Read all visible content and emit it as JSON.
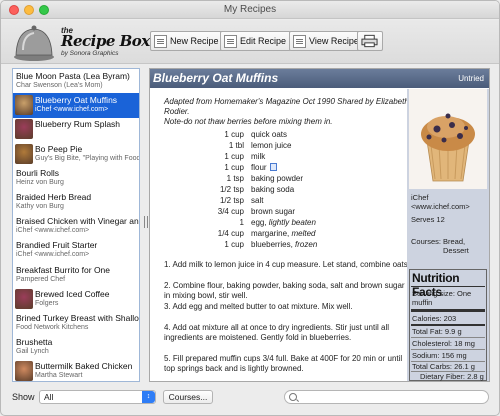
{
  "window": {
    "title": "My Recipes"
  },
  "logo": {
    "the": "the",
    "title": "Recipe Box",
    "subtitle": "by Sonora Graphics"
  },
  "toolbar": {
    "new_label": "New Recipe",
    "edit_label": "Edit Recipe",
    "view_label": "View Recipe"
  },
  "sidebar": {
    "items": [
      {
        "name": "Blue Moon Pasta (Lea Byram)",
        "source": "Char Swenson (Lea's Mom)",
        "thumb": false
      },
      {
        "name": "Blueberry Oat Muffins",
        "source": "iChef <www.ichef.com>",
        "thumb": true,
        "selected": true
      },
      {
        "name": "Blueberry Rum Splash",
        "source": "",
        "thumb": true
      },
      {
        "name": "Bo Peep Pie",
        "source": "Guy's Big Bite, \"Playing with Food\"",
        "thumb": true
      },
      {
        "name": "Bourli Rolls",
        "source": "Heinz von Burg",
        "thumb": false
      },
      {
        "name": "Braided Herb Bread",
        "source": "Kathy von Burg",
        "thumb": false
      },
      {
        "name": "Braised Chicken with Vinegar and ...",
        "source": "iChef <www.ichef.com>",
        "thumb": false
      },
      {
        "name": "Brandied Fruit Starter",
        "source": "iChef <www.ichef.com>",
        "thumb": false
      },
      {
        "name": "Breakfast Burrito for One",
        "source": "Pampered Chef",
        "thumb": false
      },
      {
        "name": "Brewed Iced Coffee",
        "source": "Folgers",
        "thumb": true
      },
      {
        "name": "Brined Turkey Breast with Shallot ...",
        "source": "Food Network Kitchens",
        "thumb": false
      },
      {
        "name": "Brushetta",
        "source": "Gail Lynch",
        "thumb": false
      },
      {
        "name": "Buttermilk Baked Chicken",
        "source": "Martha Stewart",
        "thumb": true
      }
    ]
  },
  "recipe": {
    "title": "Blueberry Oat Muffins",
    "status": "Untried",
    "intro": "Adapted from Homemaker's Magazine Oct 1990 Shared by Elizabeth Rodier.",
    "note": "Note-do not thaw berries before mixing them in.",
    "ingredients": [
      {
        "qty": "1 cup",
        "item": "quick oats",
        "note": ""
      },
      {
        "qty": "1 tbl",
        "item": "lemon juice",
        "note": ""
      },
      {
        "qty": "1 cup",
        "item": "milk",
        "note": ""
      },
      {
        "qty": "1 cup",
        "item": "flour",
        "note": ""
      },
      {
        "qty": "1 tsp",
        "item": "baking powder",
        "note": ""
      },
      {
        "qty": "1/2 tsp",
        "item": "baking soda",
        "note": ""
      },
      {
        "qty": "1/2 tsp",
        "item": "salt",
        "note": ""
      },
      {
        "qty": "3/4 cup",
        "item": "brown sugar",
        "note": ""
      },
      {
        "qty": "1",
        "item": "egg, ",
        "note": "lightly beaten"
      },
      {
        "qty": "1/4 cup",
        "item": "margarine, ",
        "note": "melted"
      },
      {
        "qty": "1 cup",
        "item": "blueberries, ",
        "note": "frozen"
      }
    ],
    "steps": [
      "1. Add milk to lemon juice in 4 cup measure. Let stand, combine oats.",
      "2. Combine flour, baking powder, baking soda, salt and brown sugar in mixing bowl, stir well.",
      "3. Add egg and melted butter to oat mixture. Mix well.",
      "4. Add oat mixture all at once to dry ingredients. Stir just until all ingredients are moistened. Gently fold in blueberries.",
      "5. Fill prepared muffin cups 3/4 full. Bake at 400F for 20 min or until top springs back and is lightly browned."
    ],
    "source": "iChef <www.ichef.com>",
    "serves": "Serves 12",
    "courses_label": "Courses:",
    "courses_value": "Bread, Dessert"
  },
  "nutrition": {
    "title": "Nutrition Facts",
    "serving": "Serving size: One muffin",
    "calories": "Calories: 203",
    "total_fat": "Total Fat: 9.9 g",
    "cholesterol": "Cholesterol: 18 mg",
    "sodium": "Sodium: 156 mg",
    "total_carbs": "Total Carbs: 26.1 g",
    "dietary_fiber": "Dietary Fiber: 2.8 g"
  },
  "bottom": {
    "show_label": "Show",
    "show_value": "All",
    "courses_button": "Courses...",
    "search_placeholder": ""
  },
  "colors": {
    "selection": "#1a63d8",
    "header_bar": "#56677f",
    "panel": "#cdd3e0"
  }
}
